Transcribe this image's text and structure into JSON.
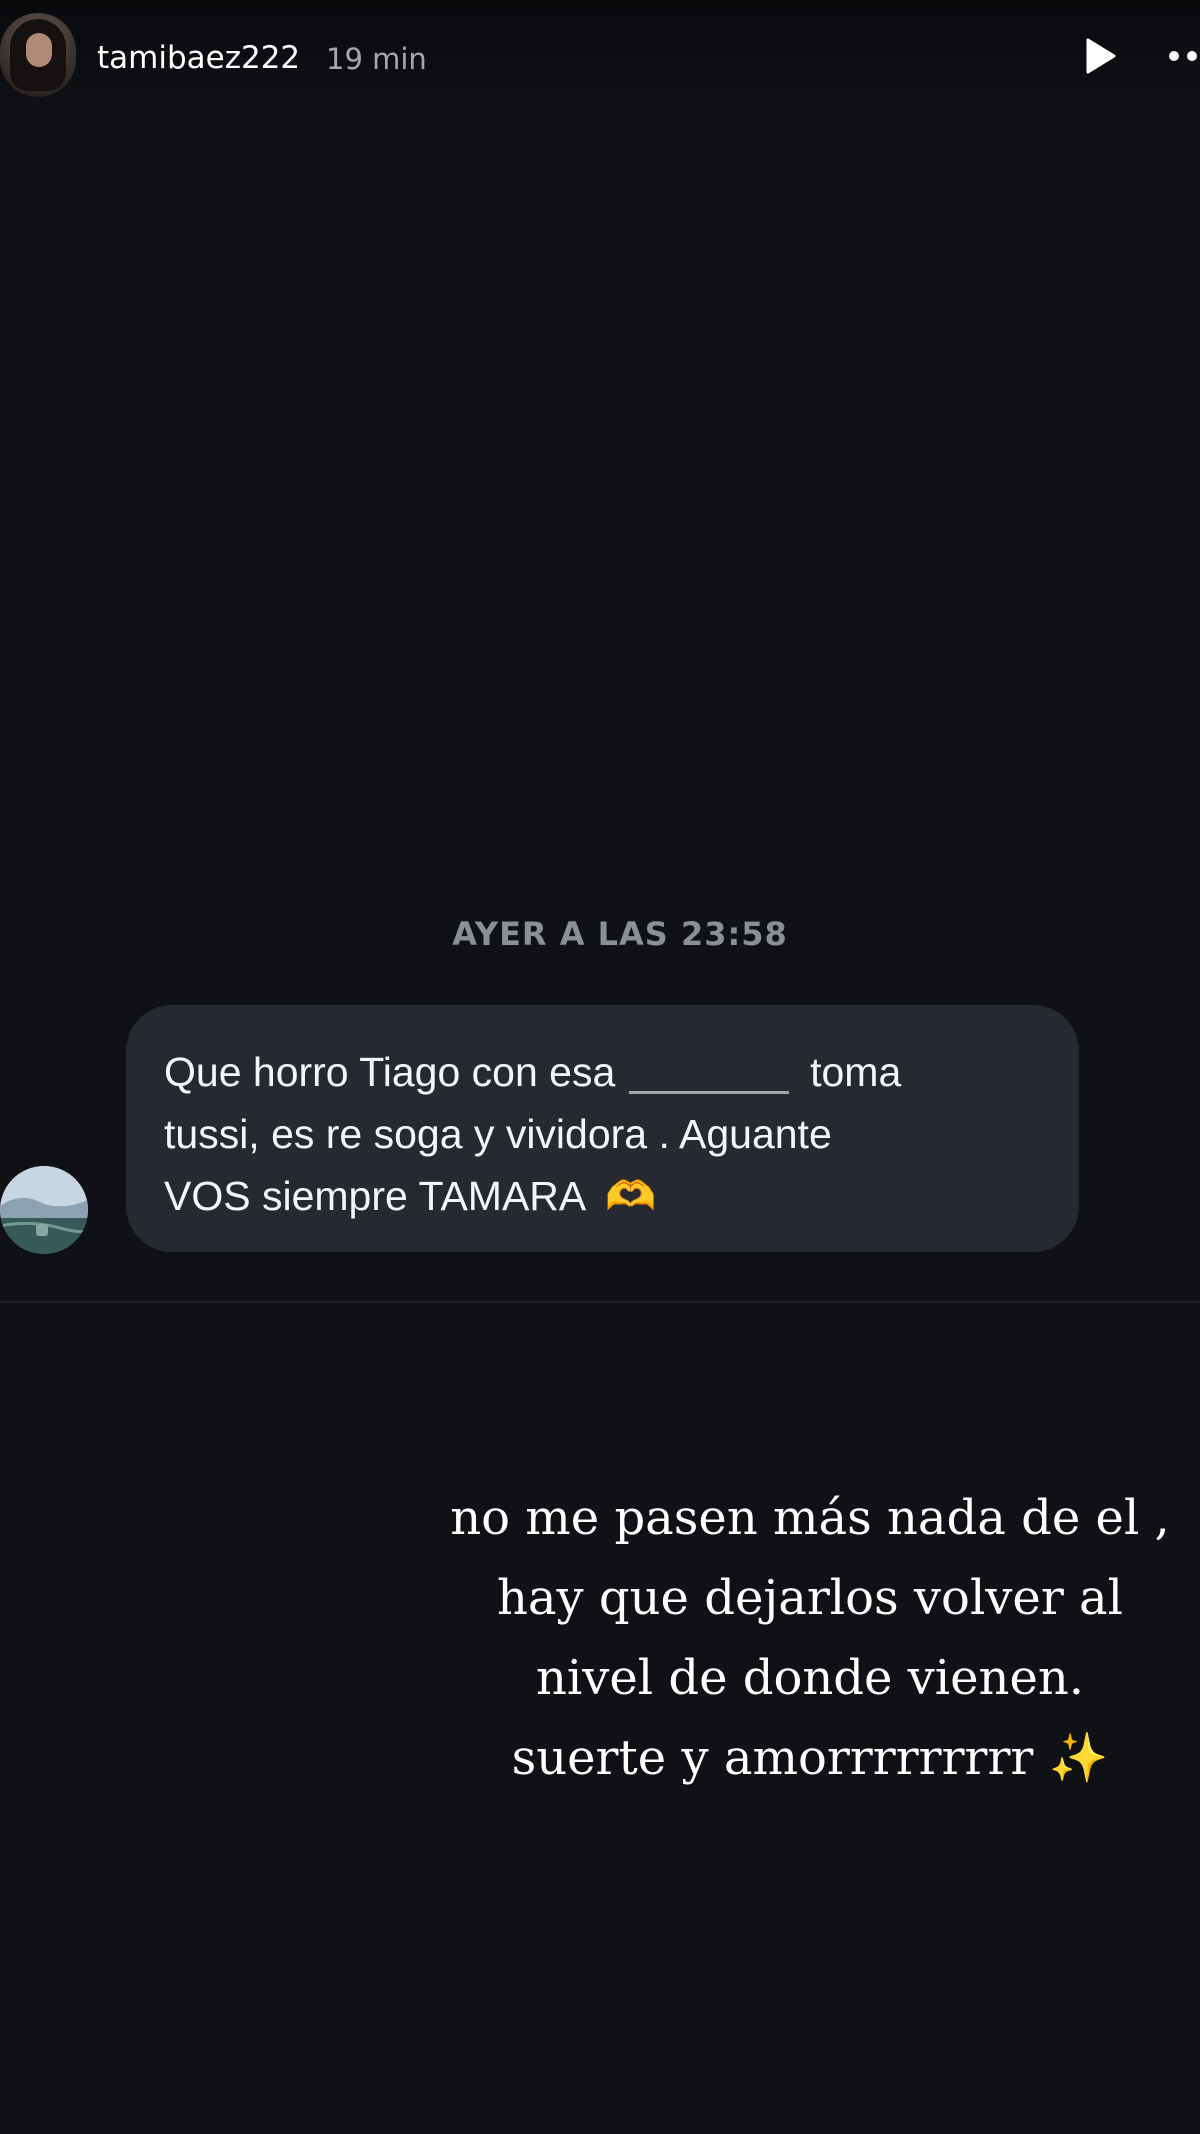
{
  "header": {
    "username": "tamibaez222",
    "time_ago": "19 min",
    "avatar_icon": "profile-avatar",
    "play_icon": "play-icon",
    "more_icon": "more-icon"
  },
  "chat": {
    "timestamp": "AYER A LAS 23:58",
    "message_lines": [
      "Que horro Tiago con esa",
      "toma",
      "tussi, es re soga y vividora . Aguante",
      "VOS siempre TAMARA"
    ],
    "emoji": "🫶",
    "sender_avatar_icon": "sender-avatar"
  },
  "caption": {
    "lines": [
      "no me pasen más nada de el ,",
      "hay que dejarlos volver al",
      "nivel de donde vienen.",
      "suerte y amorrrrrrrrr"
    ],
    "sparkle": "✨"
  },
  "colors": {
    "background": "#0f1115",
    "bubble": "#262930",
    "timestamp_text": "#8a8e95",
    "secondary_text": "#a5a7ab"
  }
}
